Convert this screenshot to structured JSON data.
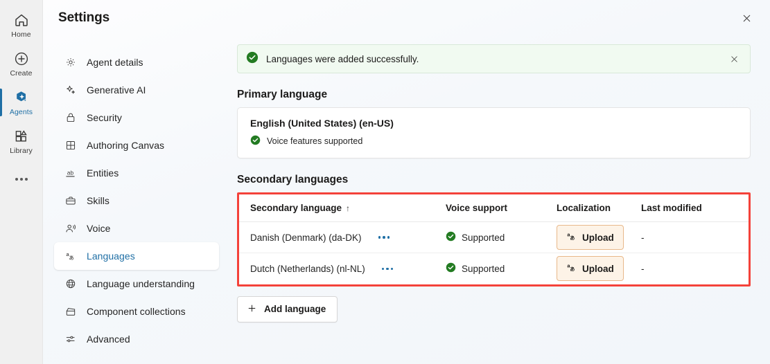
{
  "colors": {
    "accent_blue": "#1f6fa5",
    "success_green": "#237b22",
    "highlight_red": "#f4423a",
    "alert_bg": "#f1faf1",
    "upload_bg": "#fdf3e7",
    "upload_border": "#e8b88a"
  },
  "app_rail": {
    "items": [
      {
        "label": "Home",
        "icon": "home-icon",
        "active": false
      },
      {
        "label": "Create",
        "icon": "plus-circle-icon",
        "active": false
      },
      {
        "label": "Agents",
        "icon": "agents-hexagon-icon",
        "active": true
      },
      {
        "label": "Library",
        "icon": "library-grid-icon",
        "active": false
      }
    ],
    "more_label": "More"
  },
  "header": {
    "title": "Settings",
    "close_label": "Close"
  },
  "settings_nav": {
    "items": [
      {
        "label": "Agent details",
        "icon": "gear-icon",
        "selected": false
      },
      {
        "label": "Generative AI",
        "icon": "sparkle-icon",
        "selected": false
      },
      {
        "label": "Security",
        "icon": "lock-icon",
        "selected": false
      },
      {
        "label": "Authoring Canvas",
        "icon": "grid-icon",
        "selected": false
      },
      {
        "label": "Entities",
        "icon": "ab-underline-icon",
        "selected": false
      },
      {
        "label": "Skills",
        "icon": "briefcase-icon",
        "selected": false
      },
      {
        "label": "Voice",
        "icon": "voice-person-icon",
        "selected": false
      },
      {
        "label": "Languages",
        "icon": "translate-icon",
        "selected": true
      },
      {
        "label": "Language understanding",
        "icon": "globe-icon",
        "selected": false
      },
      {
        "label": "Component collections",
        "icon": "box-icon",
        "selected": false
      },
      {
        "label": "Advanced",
        "icon": "sliders-icon",
        "selected": false
      }
    ]
  },
  "alert": {
    "message": "Languages were added successfully.",
    "icon": "success-check-icon",
    "close_label": "Dismiss"
  },
  "primary_language": {
    "section_title": "Primary language",
    "name": "English (United States) (en-US)",
    "voice_status": "Voice features supported",
    "voice_icon": "success-check-icon"
  },
  "secondary_languages": {
    "section_title": "Secondary languages",
    "columns": [
      {
        "label": "Secondary language",
        "sort": "↑"
      },
      {
        "label": "Voice support",
        "sort": ""
      },
      {
        "label": "Localization",
        "sort": ""
      },
      {
        "label": "Last modified",
        "sort": ""
      }
    ],
    "rows": [
      {
        "language": "Danish (Denmark) (da-DK)",
        "voice_support": "Supported",
        "voice_icon": "success-check-icon",
        "localization_label": "Upload",
        "localization_icon": "translate-icon",
        "last_modified": "-",
        "menu_label": "More options"
      },
      {
        "language": "Dutch (Netherlands) (nl-NL)",
        "voice_support": "Supported",
        "voice_icon": "success-check-icon",
        "localization_label": "Upload",
        "localization_icon": "translate-icon",
        "last_modified": "-",
        "menu_label": "More options"
      }
    ],
    "add_button_label": "Add language",
    "add_button_icon": "plus-icon"
  }
}
